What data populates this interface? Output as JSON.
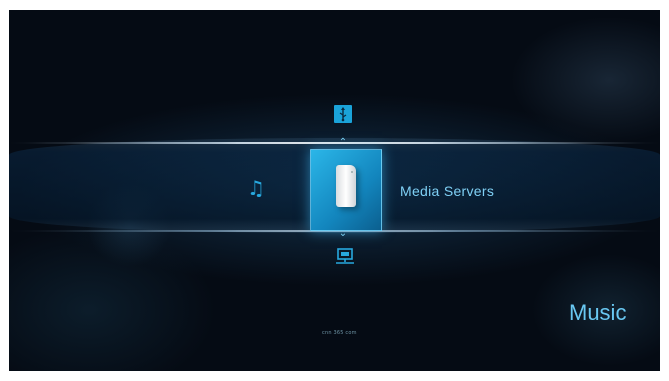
{
  "menu": {
    "selected_label": "Media Servers",
    "section_title": "Music",
    "items": [
      {
        "icon": "usb-icon"
      },
      {
        "icon": "media-server-drive-icon"
      },
      {
        "icon": "network-computer-icon"
      },
      {
        "icon": "music-note-icon"
      }
    ]
  },
  "watermark": "cnn 365 com",
  "colors": {
    "accent": "#1aa3d9",
    "label": "#7fd0f5",
    "background": "#050b14"
  }
}
